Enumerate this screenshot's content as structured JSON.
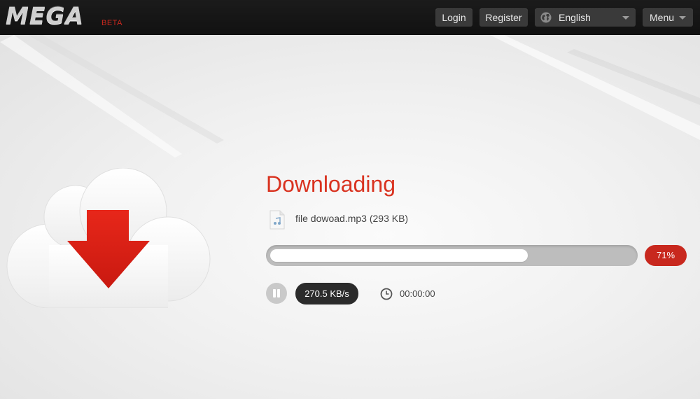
{
  "header": {
    "logo": "MEGA",
    "beta": "BETA",
    "login_label": "Login",
    "register_label": "Register",
    "language": "English",
    "menu_label": "Menu"
  },
  "download": {
    "title": "Downloading",
    "file_name": "file dowoad.mp3 (293 KB)",
    "progress_percent": 71,
    "progress_label": "71%",
    "speed": "270.5 KB/s",
    "elapsed_time": "00:00:00"
  },
  "icons": {
    "cloud": "cloud-download-icon",
    "file": "music-file-icon",
    "pause": "pause-icon",
    "clock": "clock-icon",
    "globe": "globe-icon"
  },
  "colors": {
    "accent_red": "#c8281e",
    "title_red": "#d9321f",
    "topbar": "#141414"
  }
}
